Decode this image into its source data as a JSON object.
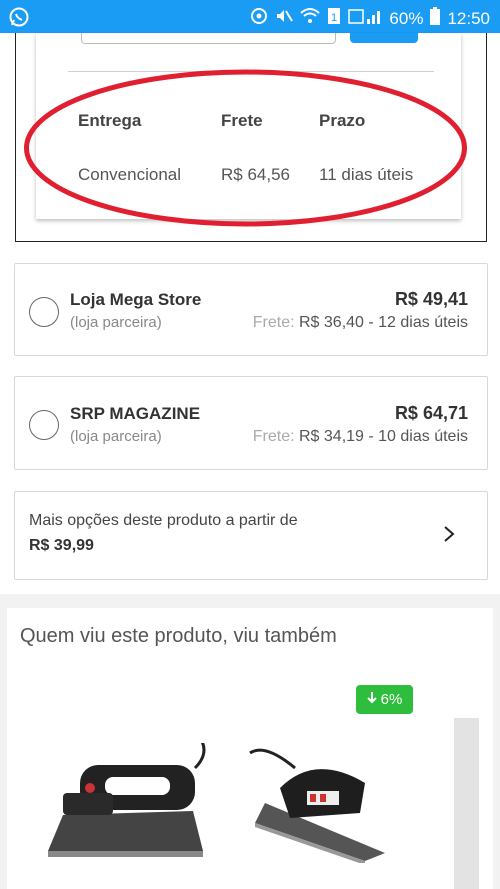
{
  "status_bar": {
    "battery_percent": "60%",
    "time": "12:50",
    "icons": [
      "whatsapp-icon",
      "sync-icon",
      "mute-icon",
      "wifi-icon",
      "sim-icon",
      "signal-icon",
      "battery-icon"
    ]
  },
  "shipping": {
    "headers": {
      "delivery": "Entrega",
      "freight": "Frete",
      "term": "Prazo"
    },
    "row": {
      "delivery": "Convencional",
      "freight": "R$ 64,56",
      "term": "11 dias úteis"
    },
    "highlight_color": "#e02030"
  },
  "offers": [
    {
      "store": "Loja Mega Store",
      "type": "(loja parceira)",
      "price": "R$ 49,41",
      "freight_label": "Frete:",
      "freight_detail": "R$ 36,40 - 12 dias úteis"
    },
    {
      "store": "SRP MAGAZINE",
      "type": "(loja parceira)",
      "price": "R$ 64,71",
      "freight_label": "Frete:",
      "freight_detail": "R$ 34,19 - 10 dias úteis"
    }
  ],
  "more_options": {
    "text": "Mais opções deste produto a partir de",
    "price": "R$ 39,99"
  },
  "recommendations": {
    "title": "Quem viu este produto, viu também",
    "badge": "6%",
    "badge_color": "#2ebd3c"
  },
  "colors": {
    "status_bar": "#1a9cf5",
    "accent": "#1a9cf5"
  }
}
